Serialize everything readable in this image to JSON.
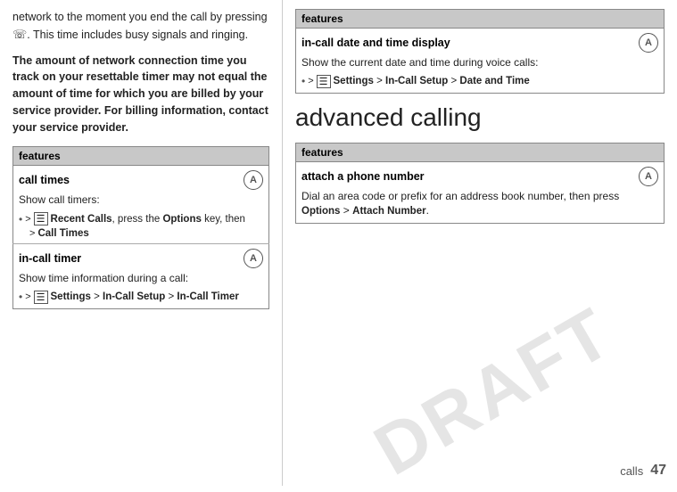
{
  "left": {
    "intro": "network to the moment you end the call by pressing",
    "intro2": ". This time includes busy signals and ringing.",
    "bold_para": "The amount of network connection time you track on your resettable timer may not equal the amount of time for which you are billed by your service provider. For billing information, contact your service provider.",
    "features_header": "features",
    "feature1": {
      "title": "call times",
      "desc": "Show call timers:",
      "nav": "> Recent Calls, press the Options key, then > Call Times"
    },
    "feature2": {
      "title": "in-call timer",
      "desc": "Show time information during a call:",
      "nav": "> Settings > In-Call Setup > In-Call Timer"
    }
  },
  "right": {
    "features_header1": "features",
    "feature3": {
      "title": "in-call date and time display",
      "desc": "Show the current date and time during voice calls:",
      "nav": "> Settings > In-Call Setup > Date and Time"
    },
    "section_heading": "advanced calling",
    "features_header2": "features",
    "feature4": {
      "title": "attach a phone number",
      "desc": "Dial an area code or prefix for an address book number, then press",
      "desc2": "Options > Attach Number."
    }
  },
  "footer": {
    "label": "calls",
    "page": "47"
  },
  "draft": "DRAFT"
}
